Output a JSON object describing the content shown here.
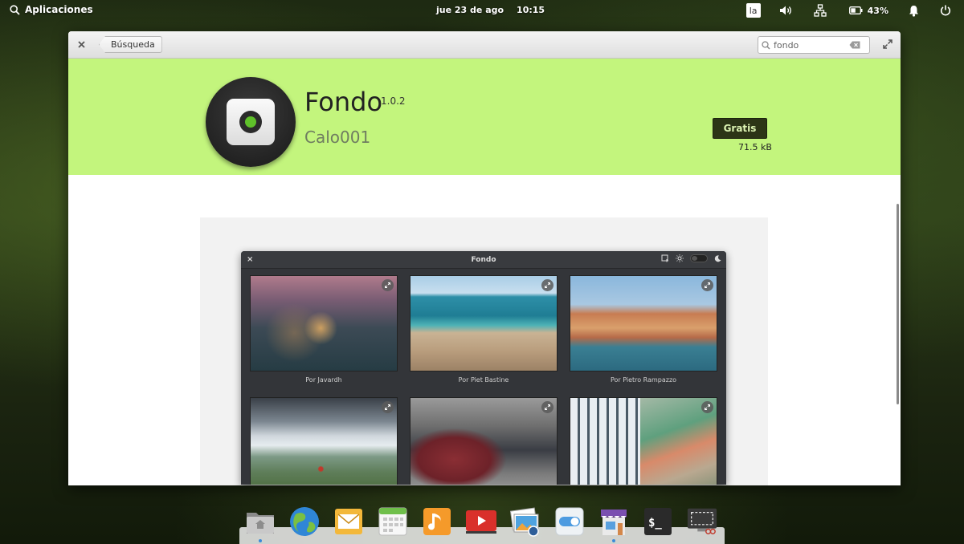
{
  "panel": {
    "applications_label": "Aplicaciones",
    "date": "jue 23 de ago",
    "time": "10:15",
    "keyboard_layout": "la",
    "battery_percent": "43%"
  },
  "window": {
    "back_label": "Búsqueda",
    "search": {
      "value": "fondo",
      "placeholder": ""
    }
  },
  "app": {
    "name": "Fondo",
    "version": "1.0.2",
    "developer": "Calo001",
    "price_button": "Gratis",
    "size": "71.5 kB",
    "accent_color": "#c3f57d"
  },
  "screenshot": {
    "window_title": "Fondo",
    "thumbnails": [
      {
        "caption": "Por Javardh",
        "scene": "bokeh-jar"
      },
      {
        "caption": "Por Piet Bastine",
        "scene": "beach"
      },
      {
        "caption": "Por Pietro Rampazzo",
        "scene": "venice"
      },
      {
        "caption": "",
        "scene": "mountain-hiker"
      },
      {
        "caption": "",
        "scene": "backpack"
      },
      {
        "caption": "",
        "scene": "buildings"
      }
    ]
  },
  "dock": {
    "items": [
      "files",
      "browser",
      "mail",
      "calendar",
      "music",
      "videos",
      "photos",
      "settings",
      "appcenter",
      "terminal",
      "screenshot"
    ]
  }
}
